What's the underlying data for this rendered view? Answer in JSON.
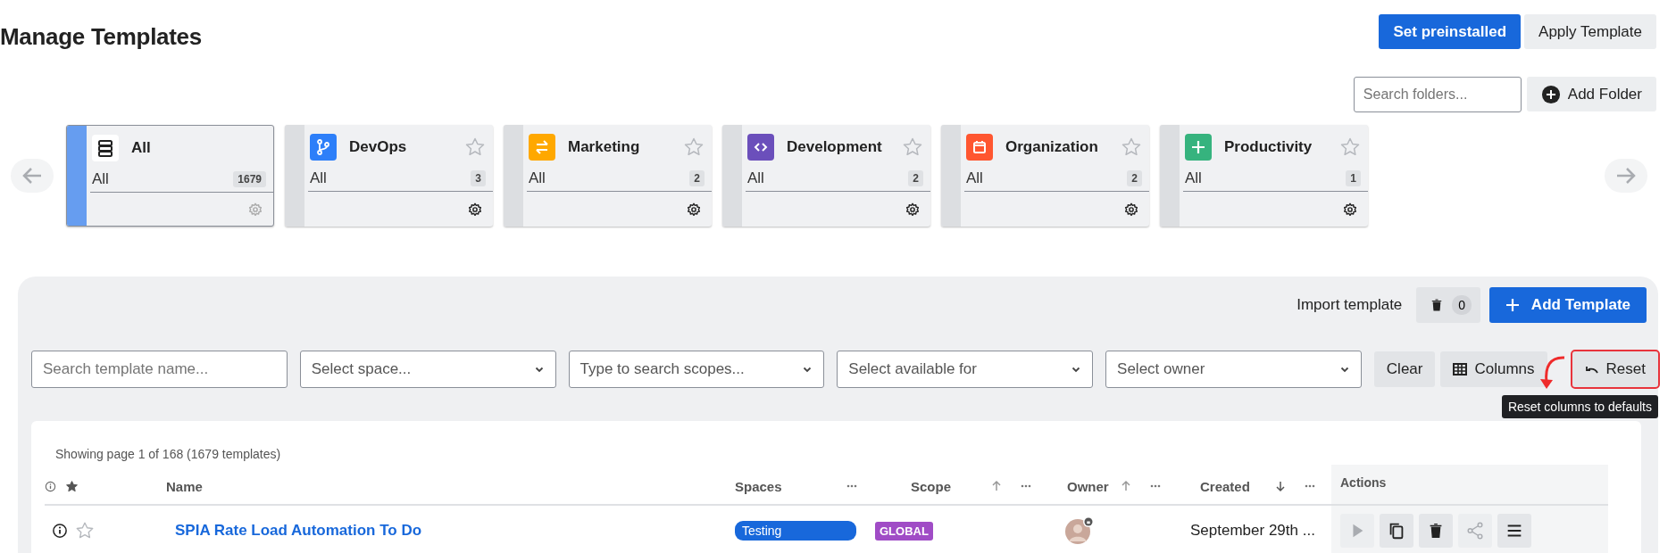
{
  "page": {
    "title": "Manage Templates"
  },
  "header_buttons": [
    {
      "label": "Set preinstalled",
      "kind": "primary"
    },
    {
      "label": "Apply Template",
      "kind": "secondary"
    }
  ],
  "folder_search": {
    "placeholder": "Search folders..."
  },
  "add_folder": {
    "label": "Add Folder"
  },
  "folders": [
    {
      "name": "All",
      "kind": "stack",
      "color": "#ffffff",
      "sub": "All",
      "count": "1679",
      "selected": true,
      "favoritable": false
    },
    {
      "name": "DevOps",
      "kind": "branch",
      "color": "#2d7ff9",
      "sub": "All",
      "count": "3",
      "selected": false,
      "favoritable": true
    },
    {
      "name": "Marketing",
      "kind": "arrows",
      "color": "#ffa800",
      "sub": "All",
      "count": "2",
      "selected": false,
      "favoritable": true
    },
    {
      "name": "Development",
      "kind": "code",
      "color": "#6b4fbb",
      "sub": "All",
      "count": "2",
      "selected": false,
      "favoritable": true
    },
    {
      "name": "Organization",
      "kind": "calendar",
      "color": "#ff5630",
      "sub": "All",
      "count": "2",
      "selected": false,
      "favoritable": true
    },
    {
      "name": "Productivity",
      "kind": "plus",
      "color": "#36b37e",
      "sub": "All",
      "count": "1",
      "selected": false,
      "favoritable": true
    }
  ],
  "toolbar": {
    "import_label": "Import template",
    "trash_count": "0",
    "add_label": "Add Template"
  },
  "filters": [
    {
      "kind": "text",
      "placeholder": "Search template name..."
    },
    {
      "kind": "select",
      "placeholder": "Select space..."
    },
    {
      "kind": "select",
      "placeholder": "Type to search scopes..."
    },
    {
      "kind": "select",
      "placeholder": "Select available for"
    },
    {
      "kind": "select",
      "placeholder": "Select owner"
    }
  ],
  "filter_buttons": [
    {
      "label": "Clear",
      "kind": "clear",
      "highlighted": false
    },
    {
      "label": "Columns",
      "kind": "columns",
      "highlighted": false
    },
    {
      "label": "Reset",
      "kind": "reset",
      "highlighted": true
    }
  ],
  "tooltip": "Reset columns to defaults",
  "table": {
    "summary": "Showing page 1 of 168 (1679 templates)",
    "columns": [
      {
        "label": "Name",
        "sortable": false,
        "menu": false
      },
      {
        "label": "Spaces",
        "sortable": false,
        "menu": true
      },
      {
        "label": "Scope",
        "sortable": true,
        "descending": false,
        "menu": true
      },
      {
        "label": "Owner",
        "sortable": true,
        "descending": false,
        "menu": true
      },
      {
        "label": "Created",
        "sortable": true,
        "descending": true,
        "menu": true
      },
      {
        "label": "Actions",
        "sortable": false,
        "menu": false
      }
    ],
    "rows": [
      {
        "starred": false,
        "name": "SPIA Rate Load Automation To Do",
        "space": "Testing",
        "scope": "GLOBAL",
        "created": "September 29th ...",
        "actions": [
          {
            "kind": "play",
            "disabled": true
          },
          {
            "kind": "copy",
            "disabled": false
          },
          {
            "kind": "trash",
            "disabled": false
          },
          {
            "kind": "share",
            "disabled": true
          },
          {
            "kind": "menu",
            "disabled": false
          }
        ]
      }
    ]
  }
}
